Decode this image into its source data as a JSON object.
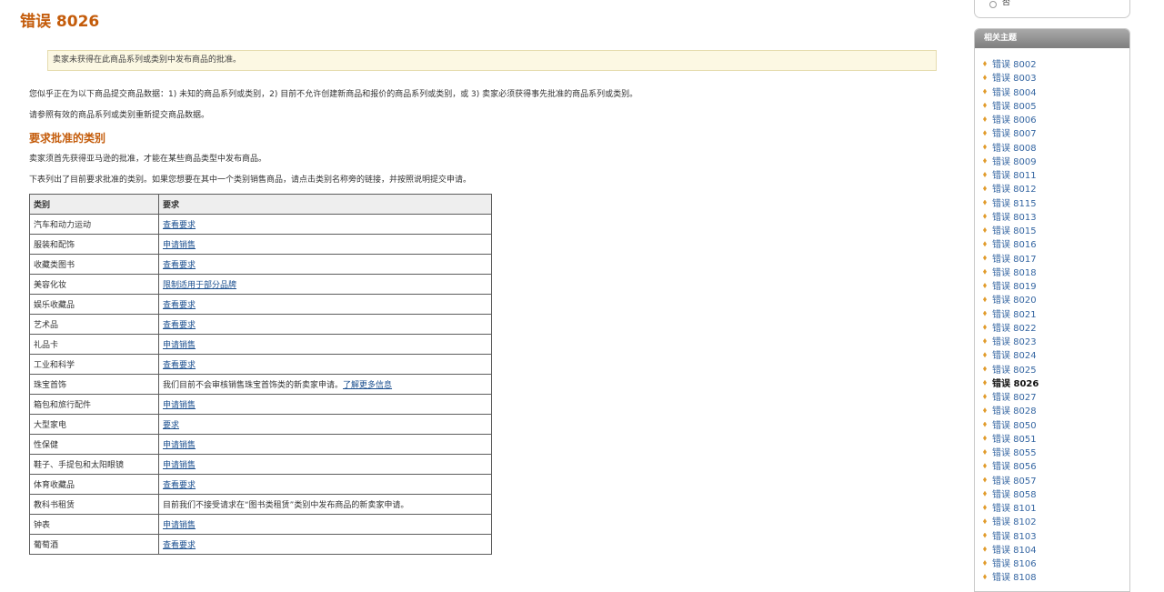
{
  "page": {
    "title": "错误 8026",
    "notice": "卖家未获得在此商品系列或类别中发布商品的批准。",
    "intro": "您似乎正在为以下商品提交商品数据：1) 未知的商品系列或类别，2) 目前不允许创建新商品和报价的商品系列或类别，或 3) 卖家必须获得事先批准的商品系列或类别。",
    "resubmit": "请参照有效的商品系列或类别重新提交商品数据。",
    "section_title": "要求批准的类别",
    "section_p1": "卖家须首先获得亚马逊的批准，才能在某些商品类型中发布商品。",
    "section_p2": "下表列出了目前要求批准的类别。如果您想要在其中一个类别销售商品，请点击类别名称旁的链接，并按照说明提交申请。"
  },
  "table": {
    "headers": [
      "类别",
      "要求"
    ],
    "rows": [
      {
        "category": "汽车和动力运动",
        "text": "",
        "link": "查看要求"
      },
      {
        "category": "服装和配饰",
        "text": "",
        "link": "申请销售"
      },
      {
        "category": "收藏类图书",
        "text": "",
        "link": "查看要求"
      },
      {
        "category": "美容化妆",
        "text": "",
        "link": "限制适用于部分品牌"
      },
      {
        "category": "娱乐收藏品",
        "text": "",
        "link": "查看要求"
      },
      {
        "category": "艺术品",
        "text": "",
        "link": "查看要求"
      },
      {
        "category": "礼品卡",
        "text": "",
        "link": "申请销售"
      },
      {
        "category": "工业和科学",
        "text": "",
        "link": "查看要求"
      },
      {
        "category": "珠宝首饰",
        "text": "我们目前不会审核销售珠宝首饰类的新卖家申请。",
        "link": "了解更多信息"
      },
      {
        "category": "箱包和旅行配件",
        "text": "",
        "link": "申请销售"
      },
      {
        "category": "大型家电",
        "text": "",
        "link": "要求"
      },
      {
        "category": "性保健",
        "text": "",
        "link": "申请销售"
      },
      {
        "category": "鞋子、手提包和太阳眼镜",
        "text": "",
        "link": "申请销售"
      },
      {
        "category": "体育收藏品",
        "text": "",
        "link": "查看要求"
      },
      {
        "category": "教科书租赁",
        "text": "目前我们不接受请求在“图书类租赁”类别中发布商品的新卖家申请。",
        "link": ""
      },
      {
        "category": "钟表",
        "text": "",
        "link": "申请销售"
      },
      {
        "category": "葡萄酒",
        "text": "",
        "link": "查看要求"
      }
    ]
  },
  "topbox": {
    "radio_label": "否"
  },
  "sidebar": {
    "title": "相关主题",
    "current": "错误 8026",
    "items": [
      "错误 8002",
      "错误 8003",
      "错误 8004",
      "错误 8005",
      "错误 8006",
      "错误 8007",
      "错误 8008",
      "错误 8009",
      "错误 8011",
      "错误 8012",
      "错误 8115",
      "错误 8013",
      "错误 8015",
      "错误 8016",
      "错误 8017",
      "错误 8018",
      "错误 8019",
      "错误 8020",
      "错误 8021",
      "错误 8022",
      "错误 8023",
      "错误 8024",
      "错误 8025",
      "错误 8026",
      "错误 8027",
      "错误 8028",
      "错误 8050",
      "错误 8051",
      "错误 8055",
      "错误 8056",
      "错误 8057",
      "错误 8058",
      "错误 8101",
      "错误 8102",
      "错误 8103",
      "错误 8104",
      "错误 8106",
      "错误 8108"
    ]
  },
  "colors": {
    "heading": "#c45c0b",
    "link": "#1b4f8f",
    "bullet": "#e19b2a",
    "notice_bg": "#fcf8e3"
  }
}
